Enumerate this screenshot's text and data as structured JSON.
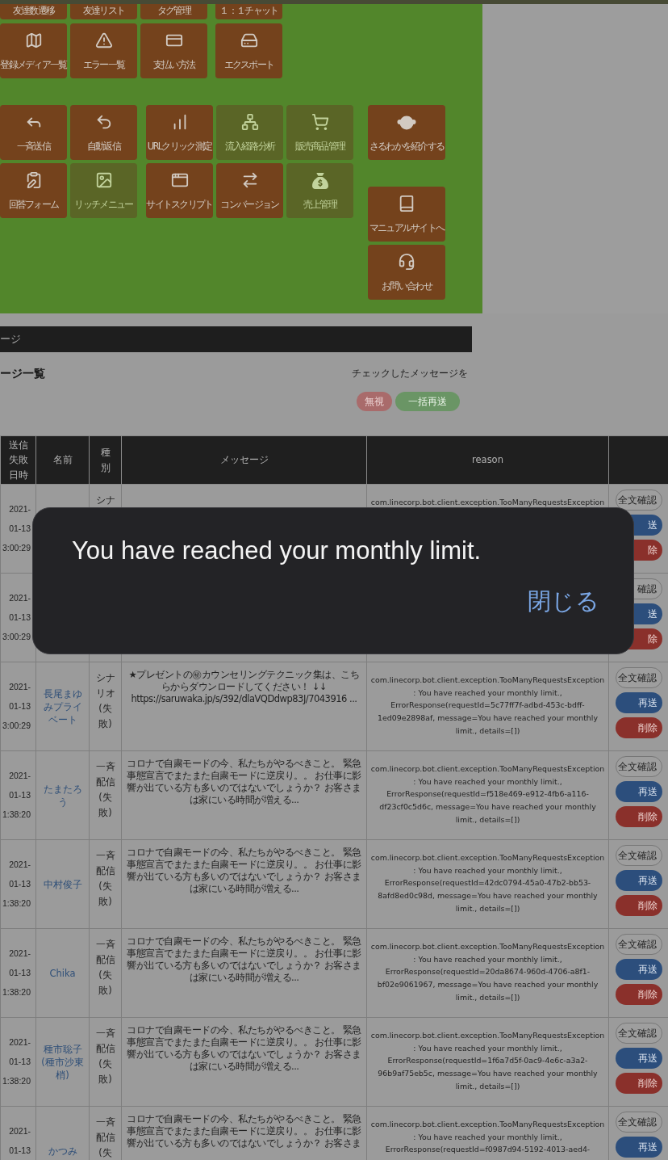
{
  "menu": {
    "top_rows": [
      {
        "tiles": [
          {
            "label": "友達数遷移",
            "disabled": false
          },
          {
            "label": "友達リスト",
            "disabled": false
          },
          {
            "label": "タグ管理",
            "disabled": false
          },
          {
            "label": "１：１チャット",
            "disabled": false
          }
        ]
      },
      {
        "tiles": [
          {
            "label": "登録メディア一覧",
            "disabled": false
          },
          {
            "label": "エラー一覧",
            "disabled": false
          },
          {
            "label": "支払い方法",
            "disabled": false
          },
          {
            "label": "エクスポート",
            "disabled": false
          }
        ]
      }
    ],
    "left_block": [
      [
        {
          "label": "一斉送信",
          "disabled": false
        },
        {
          "label": "自動返信",
          "disabled": false
        }
      ],
      [
        {
          "label": "回答フォーム",
          "disabled": false
        },
        {
          "label": "リッチメニュー",
          "disabled": true
        }
      ]
    ],
    "middle_block": [
      [
        {
          "label": "URLクリック測定",
          "disabled": false
        },
        {
          "label": "流入経路分析",
          "disabled": true
        },
        {
          "label": "販売商品管理",
          "disabled": true
        }
      ],
      [
        {
          "label": "サイトスクリプト",
          "disabled": false
        },
        {
          "label": "コンバージョン",
          "disabled": false
        },
        {
          "label": "売上管理",
          "disabled": true
        }
      ]
    ],
    "side_column": [
      {
        "label": "さるわかを紹介する",
        "disabled": false
      },
      {
        "label": "マニュアルサイトへ",
        "disabled": false
      },
      {
        "label": "お問い合わせ",
        "disabled": false
      }
    ]
  },
  "section_bar": {
    "title": "ージ"
  },
  "list": {
    "title": "ージ一覧",
    "bulk_label": "チェックしたメッセージを",
    "buttons": [
      {
        "kind": "ignore",
        "label": "無視"
      },
      {
        "kind": "resend",
        "label": "一括再送"
      }
    ]
  },
  "table": {
    "columns": [
      "送信失敗日時",
      "名前",
      "種別",
      "メッセージ",
      "reason"
    ],
    "rows": [
      {
        "sent_at": "2021-01-13 3:00:29",
        "type": "シナ",
        "reason": "com.linecorp.bot.client.exception.TooManyRequestsException:",
        "actions": [
          {
            "kind": "view",
            "label": "全文確認"
          },
          {
            "kind": "resend",
            "label": "送"
          },
          {
            "kind": "delete",
            "label": "除"
          }
        ]
      },
      {
        "sent_at": "2021-01-13 3:00:29",
        "actions": [
          {
            "kind": "view",
            "label": "確認"
          },
          {
            "kind": "resend",
            "label": "送"
          },
          {
            "kind": "delete",
            "label": "除"
          }
        ]
      },
      {
        "sent_at": "2021-01-13 3:00:29",
        "name": "長尾まゆみプライベート",
        "type": "シナリオ(失敗)",
        "message": "★プレゼントの㊙カウンセリングテクニック集は、こちらからダウンロードしてください！ ↓↓ https://saruwaka.jp/s/392/dlaVQDdwp83J/7043916 ...",
        "reason": "com.linecorp.bot.client.exception.TooManyRequestsException: You have reached your monthly limit., ErrorResponse(requestId=5c77ff7f-adbd-453c-bdff-1ed09e2898af, message=You have reached your monthly limit., details=[])",
        "actions": [
          {
            "kind": "view",
            "label": "全文確認"
          },
          {
            "kind": "resend",
            "label": "再送"
          },
          {
            "kind": "delete",
            "label": "削除"
          }
        ]
      },
      {
        "sent_at": "2021-01-13 1:38:20",
        "name": "たまたろう",
        "type": "一斉配信(失敗)",
        "message": "コロナで自粛モードの今、私たちがやるべきこと。 緊急事態宣言でまたまた自粛モードに逆戻り。。 お仕事に影響が出ている方も多いのではないでしょうか？ お客さまは家にいる時間が増える...",
        "reason": "com.linecorp.bot.client.exception.TooManyRequestsException: You have reached your monthly limit., ErrorResponse(requestId=f518e469-e912-4fb6-a116-df23cf0c5d6c, message=You have reached your monthly limit., details=[])",
        "actions": [
          {
            "kind": "view",
            "label": "全文確認"
          },
          {
            "kind": "resend",
            "label": "再送"
          },
          {
            "kind": "delete",
            "label": "削除"
          }
        ]
      },
      {
        "sent_at": "2021-01-13 1:38:20",
        "name": "中村俊子",
        "type": "一斉配信(失敗)",
        "message": "コロナで自粛モードの今、私たちがやるべきこと。 緊急事態宣言でまたまた自粛モードに逆戻り。。 お仕事に影響が出ている方も多いのではないでしょうか？ お客さまは家にいる時間が増える...",
        "reason": "com.linecorp.bot.client.exception.TooManyRequestsException: You have reached your monthly limit., ErrorResponse(requestId=42dc0794-45a0-47b2-bb53-8afd8ed0c98d, message=You have reached your monthly limit., details=[])",
        "actions": [
          {
            "kind": "view",
            "label": "全文確認"
          },
          {
            "kind": "resend",
            "label": "再送"
          },
          {
            "kind": "delete",
            "label": "削除"
          }
        ]
      },
      {
        "sent_at": "2021-01-13 1:38:20",
        "name": "Chika",
        "type": "一斉配信(失敗)",
        "message": "コロナで自粛モードの今、私たちがやるべきこと。 緊急事態宣言でまたまた自粛モードに逆戻り。。 お仕事に影響が出ている方も多いのではないでしょうか？ お客さまは家にいる時間が増える...",
        "reason": "com.linecorp.bot.client.exception.TooManyRequestsException: You have reached your monthly limit., ErrorResponse(requestId=20da8674-960d-4706-a8f1-bf02e9061967, message=You have reached your monthly limit., details=[])",
        "actions": [
          {
            "kind": "view",
            "label": "全文確認"
          },
          {
            "kind": "resend",
            "label": "再送"
          },
          {
            "kind": "delete",
            "label": "削除"
          }
        ]
      },
      {
        "sent_at": "2021-01-13 1:38:20",
        "name": "種市聡子(種市沙東梢)",
        "type": "一斉配信(失敗)",
        "message": "コロナで自粛モードの今、私たちがやるべきこと。 緊急事態宣言でまたまた自粛モードに逆戻り。。 お仕事に影響が出ている方も多いのではないでしょうか？ お客さまは家にいる時間が増える...",
        "reason": "com.linecorp.bot.client.exception.TooManyRequestsException: You have reached your monthly limit., ErrorResponse(requestId=1f6a7d5f-0ac9-4e6c-a3a2-96b9af75eb5c, message=You have reached your monthly limit., details=[])",
        "actions": [
          {
            "kind": "view",
            "label": "全文確認"
          },
          {
            "kind": "resend",
            "label": "再送"
          },
          {
            "kind": "delete",
            "label": "削除"
          }
        ]
      },
      {
        "sent_at": "2021-01-13",
        "name": "かつみ",
        "type": "一斉配信(失",
        "message": "コロナで自粛モードの今、私たちがやるべきこと。 緊急事態宣言でまたまた自粛モードに逆戻り。。 お仕事に影響が出ている方も多いのではないでしょうか？ お客さま",
        "reason": "com.linecorp.bot.client.exception.TooManyRequestsException: You have reached your monthly limit., ErrorResponse(requestId=f0987d94-5192-4013-aed4-",
        "actions": [
          {
            "kind": "view",
            "label": "全文確認"
          },
          {
            "kind": "resend",
            "label": "再送"
          }
        ]
      }
    ]
  },
  "dialog": {
    "message": "You have reached your monthly limit.",
    "button": "閉じる"
  }
}
